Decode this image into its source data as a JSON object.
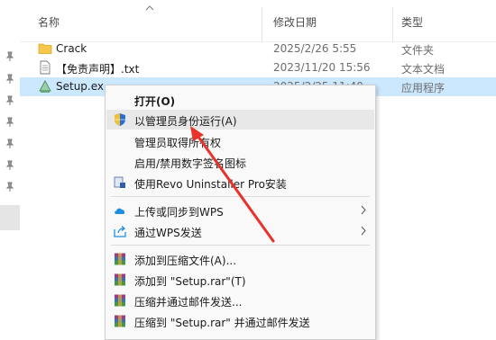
{
  "header": {
    "name_col": "名称",
    "date_col": "修改日期",
    "type_col": "类型"
  },
  "files": [
    {
      "name": "Crack",
      "date": "2025/2/26 5:55",
      "type": "文件夹",
      "icon": "folder-icon"
    },
    {
      "name": "【免责声明】.txt",
      "date": "2023/11/20 15:56",
      "type": "文本文档",
      "icon": "text-file-icon"
    },
    {
      "name": "Setup.ex",
      "date": "2025/2/25 11:40",
      "type": "应用程序",
      "icon": "installer-icon"
    }
  ],
  "menu": {
    "open": "打开(O)",
    "run_as_admin": "以管理员身份运行(A)",
    "take_ownership": "管理员取得所有权",
    "toggle_digital_sig": "启用/禁用数字签名图标",
    "revo": "使用Revo Uninstaller Pro安装",
    "wps_upload": "上传或同步到WPS",
    "wps_send": "通过WPS发送",
    "add_archive": "添加到压缩文件(A)...",
    "add_setup_rar": "添加到 \"Setup.rar\"(T)",
    "compress_email": "压缩并通过邮件发送...",
    "compress_setup_email": "压缩到 \"Setup.rar\" 并通过邮件发送"
  },
  "colors": {
    "selection": "#cce8ff",
    "highlight": "#e8e8e8",
    "annotation_arrow": "#e8322a",
    "folder": "#f5c84c"
  }
}
